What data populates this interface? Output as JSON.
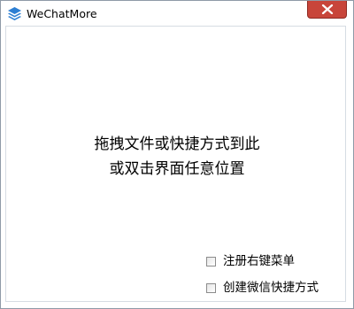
{
  "window": {
    "title": "WeChatMore",
    "app_icon": "stack-layers-icon",
    "close_icon": "close-icon",
    "accent_close": "#c8453a",
    "icon_color": "#2d7fd3"
  },
  "drop_area": {
    "line1": "拖拽文件或快捷方式到此",
    "line2": "或双击界面任意位置"
  },
  "options": {
    "register_context_menu": {
      "label": "注册右键菜单",
      "checked": false
    },
    "create_wechat_shortcut": {
      "label": "创建微信快捷方式",
      "checked": false
    }
  }
}
